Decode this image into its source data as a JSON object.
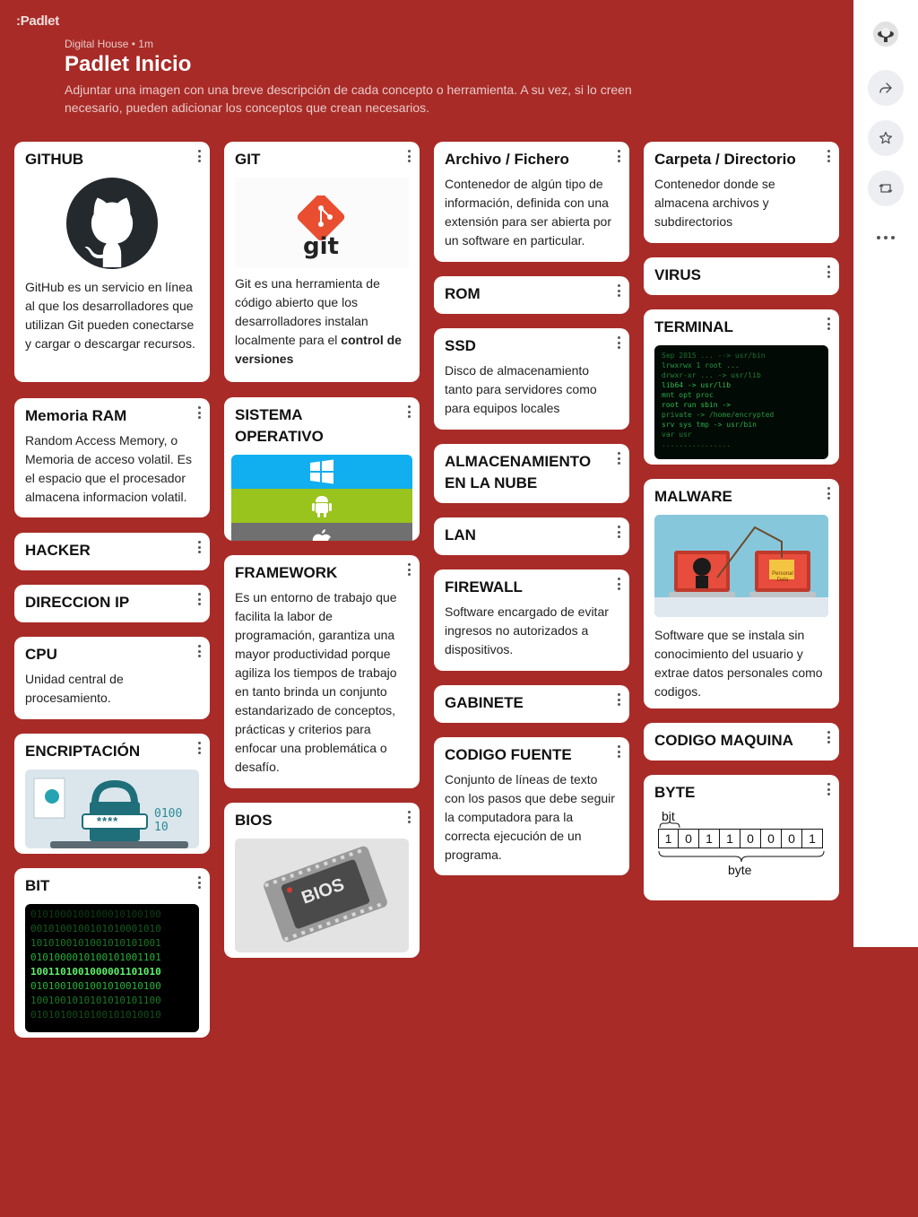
{
  "app": {
    "logo": ":Padlet"
  },
  "header": {
    "author": "Digital House",
    "time": "1m",
    "title": "Padlet Inicio",
    "description": "Adjuntar una imagen con una breve descripción de cada concepto o herramienta. A su vez, si lo creen necesario, pueden adicionar los conceptos que crean necesarios."
  },
  "colors": {
    "background": "#a82b27",
    "card": "#ffffff",
    "rail": "#ffffff"
  },
  "rail": {
    "icons": [
      "avatar",
      "share-icon",
      "star-icon",
      "remake-icon",
      "more-icon"
    ]
  },
  "cards": {
    "github": {
      "title": "GITHUB",
      "body": "GitHub es un servicio en línea al que los desarrolladores que utilizan Git pueden conectarse y cargar o descargar recursos.",
      "image": "github-logo"
    },
    "git": {
      "title": "GIT",
      "body_pre": "Git es una herramienta de código abierto que los desarrolladores instalan localmente para el ",
      "body_bold": "control de versiones",
      "image_text": "git"
    },
    "archivo": {
      "title": "Archivo / Fichero",
      "body": "Contenedor de algún tipo de información, definida con una extensión para ser abierta por un software en particular."
    },
    "carpeta": {
      "title": "Carpeta / Directorio",
      "body": "Contenedor donde se almacena archivos y subdirectorios"
    },
    "virus": {
      "title": "VIRUS"
    },
    "rom": {
      "title": "ROM"
    },
    "terminal": {
      "title": "TERMINAL",
      "image": "terminal-screen"
    },
    "ssd": {
      "title": "SSD",
      "body": "Disco de almacenamiento tanto para servidores como para equipos locales"
    },
    "memoria": {
      "title": "Memoria RAM",
      "body": "Random Access Memory, o Memoria de acceso volatil. Es el espacio que el procesador almacena informacion volatil."
    },
    "so": {
      "title": "SISTEMA OPERATIVO",
      "image": "windows-android-apple"
    },
    "nube": {
      "title": "ALMACENAMIENTO EN LA NUBE"
    },
    "malware": {
      "title": "MALWARE",
      "body": "Software que se instala sin conocimiento del usuario y extrae datos personales como codigos.",
      "image_text": "Personal Data"
    },
    "lan": {
      "title": "LAN"
    },
    "hacker": {
      "title": "HACKER"
    },
    "framework": {
      "title": "FRAMEWORK",
      "body": "Es un entorno de trabajo que facilita la labor de programación, garantiza una mayor productividad porque agiliza los tiempos de trabajo en tanto brinda un conjunto estandarizado de conceptos, prácticas y criterios para enfocar una problemática o desafío."
    },
    "firewall": {
      "title": "FIREWALL",
      "body": "Software encargado de evitar ingresos no autorizados a dispositivos."
    },
    "ip": {
      "title": "DIRECCION IP"
    },
    "cpu": {
      "title": "CPU",
      "body": "Unidad central de procesamiento."
    },
    "gabinete": {
      "title": "GABINETE"
    },
    "codigo_maquina": {
      "title": "CODIGO MAQUINA"
    },
    "encriptacion": {
      "title": "ENCRIPTACIÓN",
      "image_text": "****",
      "image_bits": "0100 10"
    },
    "codigo_fuente": {
      "title": "CODIGO FUENTE",
      "body": "Conjunto de líneas de texto con los pasos que debe seguir la computadora para la correcta ejecución de un programa."
    },
    "byte": {
      "title": "BYTE",
      "label_bit": "bit",
      "label_byte": "byte",
      "bits": [
        "1",
        "0",
        "1",
        "1",
        "0",
        "0",
        "0",
        "1"
      ]
    },
    "bios": {
      "title": "BIOS",
      "image_text": "BIOS"
    },
    "bit": {
      "title": "BIT",
      "image": "binary-matrix"
    }
  }
}
